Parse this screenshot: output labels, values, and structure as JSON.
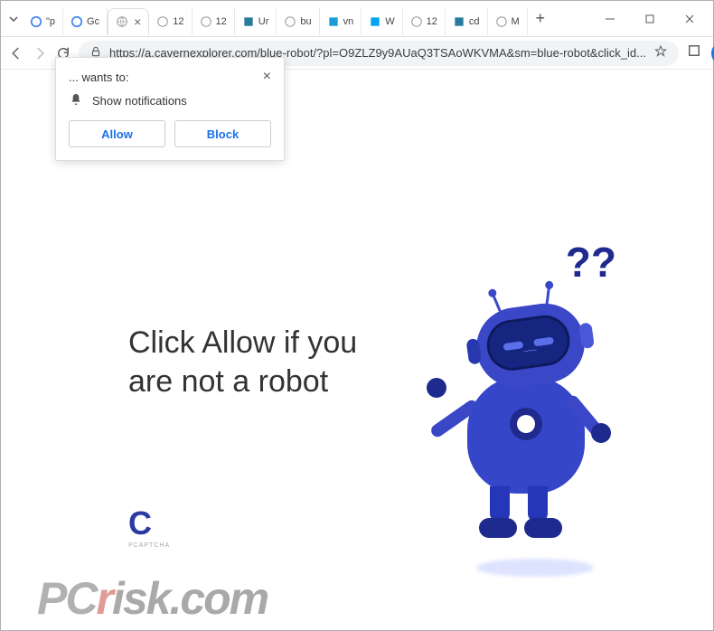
{
  "window": {
    "tabs": [
      {
        "label": "\"p"
      },
      {
        "label": "Gc"
      },
      {
        "label": ""
      },
      {
        "label": "12"
      },
      {
        "label": "12"
      },
      {
        "label": "Ur"
      },
      {
        "label": "bu"
      },
      {
        "label": "vn"
      },
      {
        "label": "W"
      },
      {
        "label": "12"
      },
      {
        "label": "cd"
      },
      {
        "label": "M"
      }
    ]
  },
  "addressbar": {
    "url": "https://a.cavernexplorer.com/blue-robot/?pl=O9ZLZ9y9AUaQ3TSAoWKVMA&sm=blue-robot&click_id..."
  },
  "prompt": {
    "title": "... wants to:",
    "permission": "Show notifications",
    "allow": "Allow",
    "block": "Block"
  },
  "page": {
    "heading": "Click Allow if you are not a robot",
    "questionmarks": "??",
    "logo_sub": "PCAPTCHA"
  },
  "watermark": {
    "pc": "PC",
    "r": "r",
    "rest": "isk.com"
  }
}
